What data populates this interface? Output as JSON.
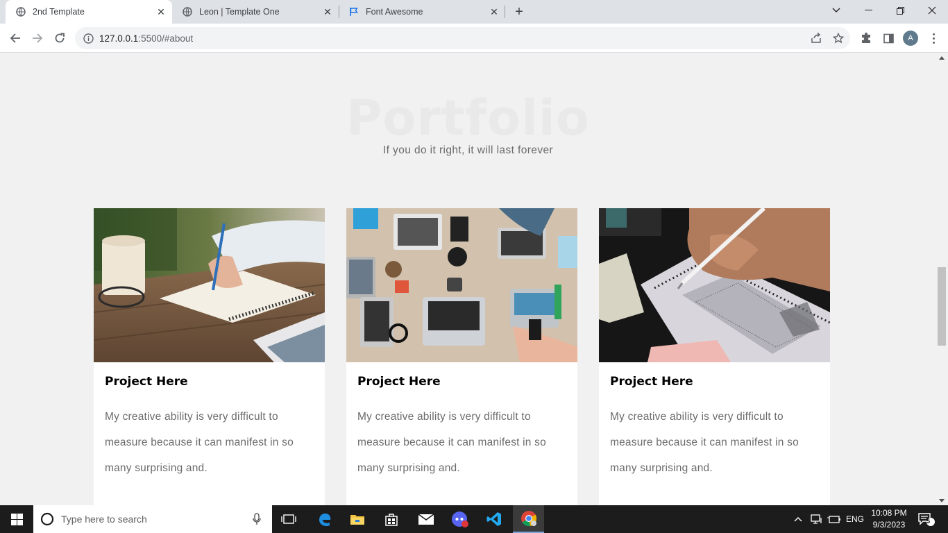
{
  "browser": {
    "tabs": [
      {
        "title": "2nd Template",
        "favicon": "globe-icon",
        "active": true
      },
      {
        "title": "Leon | Template One",
        "favicon": "globe-icon",
        "active": false
      },
      {
        "title": "Font Awesome",
        "favicon": "flag-icon",
        "active": false
      }
    ],
    "url_host": "127.0.0.1",
    "url_path": ":5500/#about",
    "profile_initial": "A"
  },
  "page": {
    "section_title": "Portfolio",
    "section_subtitle": "If you do it right, it will last forever",
    "projects": [
      {
        "title": "Project Here",
        "description": "My creative ability is very difficult to measure because it can manifest in so many surprising and.",
        "image": "notebook-writing-photo"
      },
      {
        "title": "Project Here",
        "description": "My creative ability is very difficult to measure because it can manifest in so many surprising and.",
        "image": "team-laptops-desk-photo"
      },
      {
        "title": "Project Here",
        "description": "My creative ability is very difficult to measure because it can manifest in so many surprising and.",
        "image": "answer-sheet-pencil-photo"
      }
    ]
  },
  "taskbar": {
    "search_placeholder": "Type here to search",
    "language": "ENG",
    "time": "10:08 PM",
    "date": "9/3/2023",
    "notification_count": "5"
  },
  "colors": {
    "accent_blue": "#1a73e8",
    "text_gray": "#6b6b6b",
    "page_bg": "#f1f1f1"
  }
}
